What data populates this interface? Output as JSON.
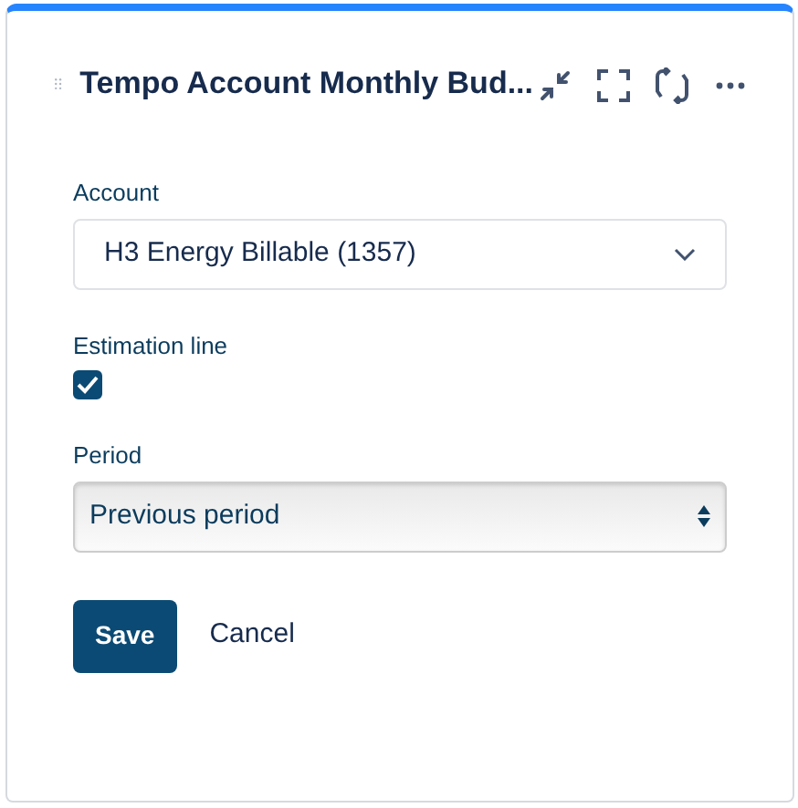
{
  "title": "Tempo Account Monthly Bud...",
  "fields": [
    {
      "kind": "dropdown",
      "label": "Account",
      "value": "H3 Energy Billable (1357)"
    },
    {
      "kind": "checkbox",
      "label": "Estimation line",
      "checked": true
    },
    {
      "kind": "select",
      "label": "Period",
      "value": "Previous period"
    }
  ],
  "buttons": [
    {
      "label": "Save",
      "primary": true
    },
    {
      "label": "Cancel",
      "primary": false
    }
  ]
}
